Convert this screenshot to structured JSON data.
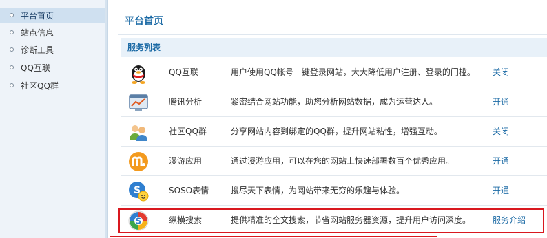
{
  "sidebar": {
    "items": [
      {
        "label": "平台首页",
        "active": true
      },
      {
        "label": "站点信息"
      },
      {
        "label": "诊断工具"
      },
      {
        "label": "QQ互联"
      },
      {
        "label": "社区QQ群"
      }
    ]
  },
  "main": {
    "title": "平台首页",
    "section_title": "服务列表",
    "services": [
      {
        "name": "QQ互联",
        "description": "用户使用QQ帐号一键登录网站，大大降低用户注册、登录的门槛。",
        "action": "关闭",
        "icon": "qq-penguin-icon"
      },
      {
        "name": "腾讯分析",
        "description": "紧密结合网站功能，助您分析网站数据，成为运营达人。",
        "action": "开通",
        "icon": "analytics-chart-icon"
      },
      {
        "name": "社区QQ群",
        "description": "分享网站内容到绑定的QQ群，提升网站粘性，增强互动。",
        "action": "关闭",
        "icon": "group-users-icon"
      },
      {
        "name": "漫游应用",
        "description": "通过漫游应用，可以在您的网站上快速部署数百个优秀应用。",
        "action": "开通",
        "icon": "roaming-app-icon"
      },
      {
        "name": "SOSO表情",
        "description": "搜尽天下表情，为网站带来无穷的乐趣与体验。",
        "action": "开通",
        "icon": "soso-emoticon-icon"
      },
      {
        "name": "纵横搜索",
        "description": "提供精准的全文搜索，节省网站服务器资源，提升用户访问深度。",
        "action": "服务介绍",
        "icon": "search-logo-icon"
      }
    ]
  },
  "colors": {
    "accent": "#1b6aa5",
    "highlight": "#d9181f",
    "sidebar_bg": "#eef3f9",
    "sidebar_active": "#cfe0f0"
  }
}
